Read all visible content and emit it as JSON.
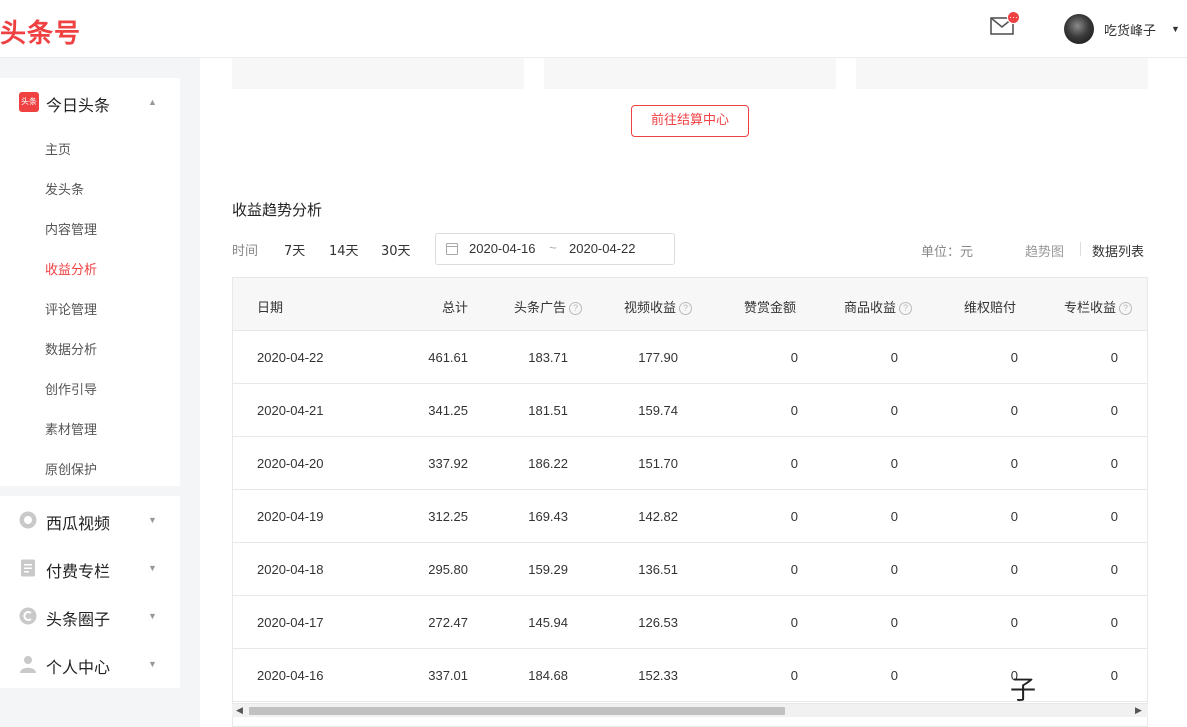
{
  "header": {
    "logo": "头条号",
    "mail_badge": "···",
    "username": "吃货峰子",
    "username_caret": "▼"
  },
  "sidebar": {
    "toutiao_badge": "头条",
    "toutiao": {
      "label": "今日头条",
      "caret": "▲",
      "items": [
        {
          "label": "主页"
        },
        {
          "label": "发头条"
        },
        {
          "label": "内容管理"
        },
        {
          "label": "收益分析",
          "active": true
        },
        {
          "label": "评论管理"
        },
        {
          "label": "数据分析"
        },
        {
          "label": "创作引导"
        },
        {
          "label": "素材管理"
        },
        {
          "label": "原创保护"
        }
      ]
    },
    "groups": [
      {
        "label": "西瓜视频",
        "icon": "play-circle-icon",
        "caret": "▼"
      },
      {
        "label": "付费专栏",
        "icon": "document-icon",
        "caret": "▼"
      },
      {
        "label": "头条圈子",
        "icon": "circle-c-icon",
        "caret": "▼"
      },
      {
        "label": "个人中心",
        "icon": "person-icon",
        "caret": "▼"
      }
    ]
  },
  "main": {
    "settle_button": "前往结算中心",
    "section_title": "收益趋势分析",
    "time_label": "时间",
    "ranges": [
      "7天",
      "14天",
      "30天"
    ],
    "date_range": {
      "start": "2020-04-16",
      "separator": "~",
      "end": "2020-04-22"
    },
    "unit": "单位：元",
    "view_trend": "趋势图",
    "view_list": "数据列表"
  },
  "table": {
    "columns": [
      {
        "label": "日期",
        "help": false
      },
      {
        "label": "总计",
        "help": false
      },
      {
        "label": "头条广告",
        "help": true
      },
      {
        "label": "视频收益",
        "help": true
      },
      {
        "label": "赞赏金额",
        "help": false
      },
      {
        "label": "商品收益",
        "help": true
      },
      {
        "label": "维权赔付",
        "help": false
      },
      {
        "label": "专栏收益",
        "help": true
      }
    ],
    "help_glyph": "?",
    "rows": [
      [
        "2020-04-22",
        "461.61",
        "183.71",
        "177.90",
        "0",
        "0",
        "0",
        "0"
      ],
      [
        "2020-04-21",
        "341.25",
        "181.51",
        "159.74",
        "0",
        "0",
        "0",
        "0"
      ],
      [
        "2020-04-20",
        "337.92",
        "186.22",
        "151.70",
        "0",
        "0",
        "0",
        "0"
      ],
      [
        "2020-04-19",
        "312.25",
        "169.43",
        "142.82",
        "0",
        "0",
        "0",
        "0"
      ],
      [
        "2020-04-18",
        "295.80",
        "159.29",
        "136.51",
        "0",
        "0",
        "0",
        "0"
      ],
      [
        "2020-04-17",
        "272.47",
        "145.94",
        "126.53",
        "0",
        "0",
        "0",
        "0"
      ],
      [
        "2020-04-16",
        "337.01",
        "184.68",
        "152.33",
        "0",
        "0",
        "0",
        "0"
      ]
    ]
  },
  "scrollbar": {
    "left_arrow": "◀",
    "right_arrow": "▶"
  },
  "watermark": "子",
  "colors": {
    "accent": "#f04142",
    "text": "#222222",
    "muted": "#888888",
    "header_bg": "#f7f7f7"
  }
}
